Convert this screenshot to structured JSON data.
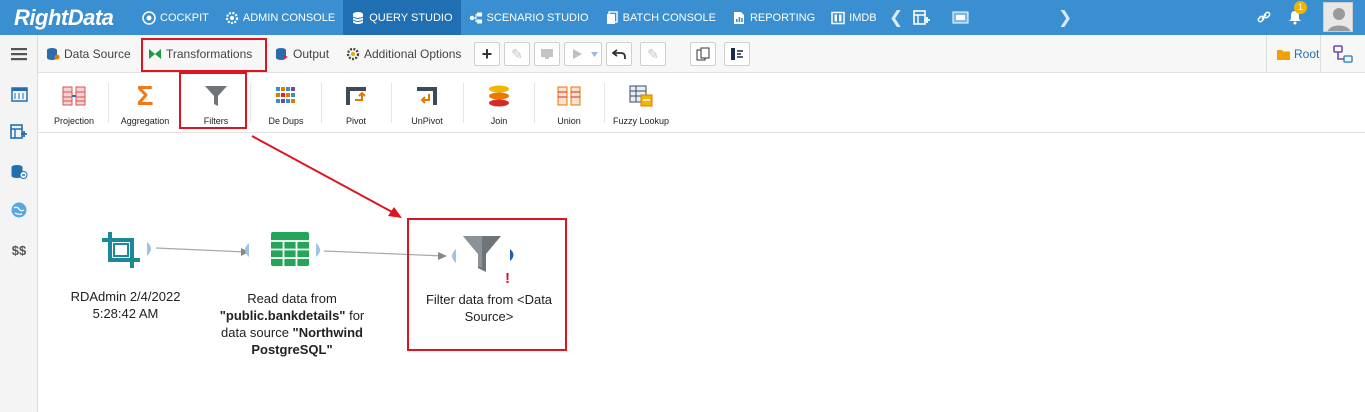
{
  "app": {
    "logo_text": "RightData",
    "colors": {
      "topbar": "#3a8fd0",
      "active_nav": "#1f6fb2",
      "highlight": "#e0141e"
    }
  },
  "nav": {
    "items": [
      {
        "label": "COCKPIT",
        "icon": "cockpit-icon"
      },
      {
        "label": "ADMIN CONSOLE",
        "icon": "gear-icon"
      },
      {
        "label": "QUERY STUDIO",
        "icon": "database-icon",
        "active": true
      },
      {
        "label": "SCENARIO STUDIO",
        "icon": "scenario-icon"
      },
      {
        "label": "BATCH CONSOLE",
        "icon": "batch-icon"
      },
      {
        "label": "REPORTING",
        "icon": "report-icon"
      },
      {
        "label": "IMDB",
        "icon": "imdb-icon"
      }
    ],
    "notification_count": "1"
  },
  "toolbar": {
    "data_source_label": "Data Source",
    "transformations_label": "Transformations",
    "output_label": "Output",
    "additional_options_label": "Additional Options",
    "root_label": "Root"
  },
  "palette": {
    "items": [
      {
        "label": "Projection",
        "icon": "projection-icon"
      },
      {
        "label": "Aggregation",
        "icon": "sigma-icon"
      },
      {
        "label": "Filters",
        "icon": "funnel-icon"
      },
      {
        "label": "De Dups",
        "icon": "dedup-icon"
      },
      {
        "label": "Pivot",
        "icon": "pivot-icon"
      },
      {
        "label": "UnPivot",
        "icon": "unpivot-icon"
      },
      {
        "label": "Join",
        "icon": "join-icon"
      },
      {
        "label": "Union",
        "icon": "union-icon"
      },
      {
        "label": "Fuzzy  Lookup",
        "icon": "fuzzy-lookup-icon"
      }
    ]
  },
  "sidebar": {
    "items": [
      {
        "icon": "menu-icon"
      },
      {
        "icon": "calendar-table-icon"
      },
      {
        "icon": "add-table-icon"
      },
      {
        "icon": "database-link-icon"
      },
      {
        "icon": "globe-icon"
      },
      {
        "label": "$$",
        "icon": "dollar-icon"
      }
    ]
  },
  "canvas": {
    "node1": {
      "line1": "RDAdmin 2/4/2022",
      "line2": "5:28:42 AM"
    },
    "node2": {
      "p1": "Read data from",
      "p2": "\"public.bankdetails\"",
      "p3": " for",
      "p4": "data source ",
      "p5": "\"Northwind",
      "p6": "PostgreSQL\""
    },
    "node3": {
      "line1": "Filter data from <Data",
      "line2": "Source>",
      "warning": "!"
    }
  }
}
